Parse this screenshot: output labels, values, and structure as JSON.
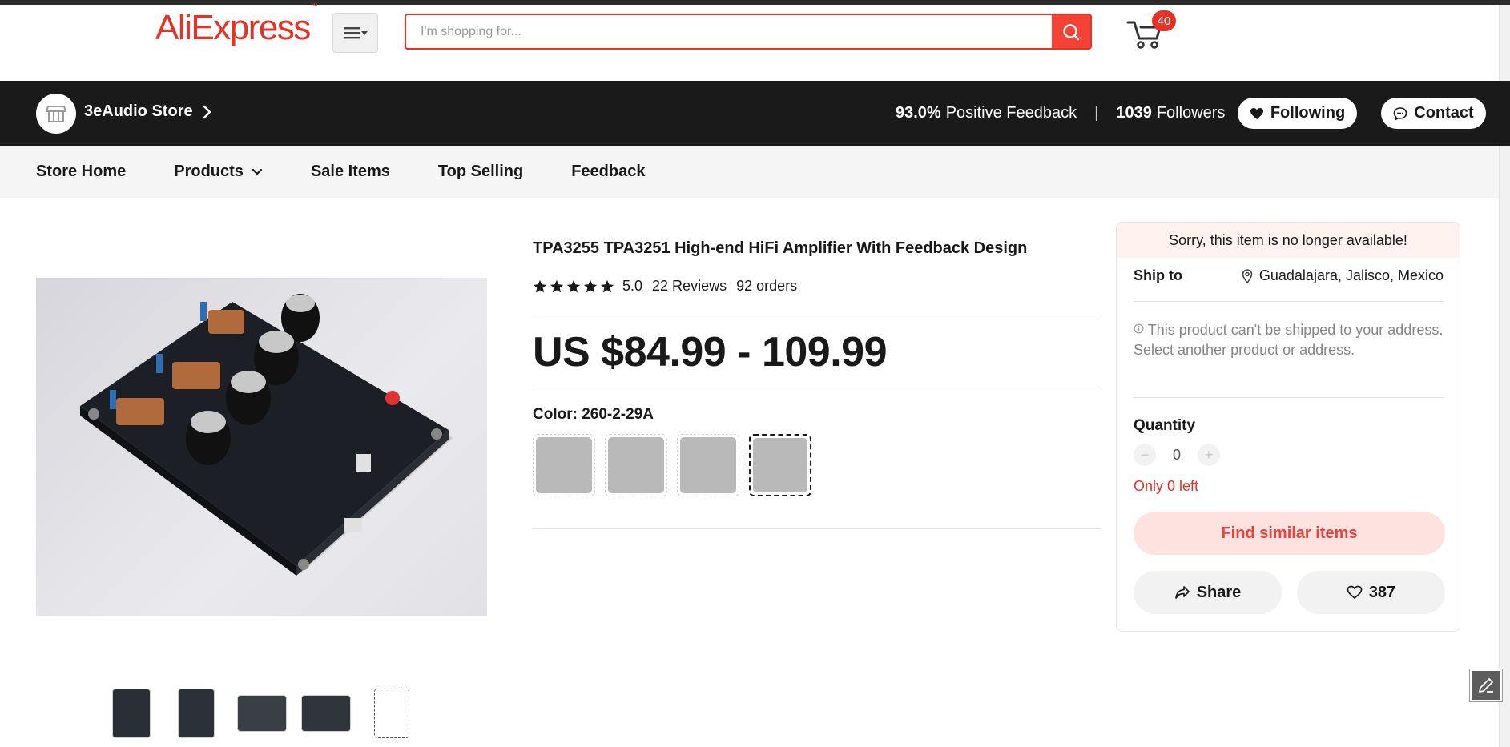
{
  "header": {
    "logo_text": "AliExpress",
    "logo_mark": "™",
    "search_placeholder": "I'm shopping for...",
    "cart_count": "40",
    "brand_color": "#e43225"
  },
  "store": {
    "name": "3eAudio Store",
    "feedback_value": "93.0%",
    "feedback_label": "Positive Feedback",
    "followers_value": "1039",
    "followers_label": "Followers",
    "separator": "|",
    "following_label": "Following",
    "contact_label": "Contact"
  },
  "store_nav": {
    "items": [
      {
        "label": "Store Home"
      },
      {
        "label": "Products"
      },
      {
        "label": "Sale Items"
      },
      {
        "label": "Top Selling"
      },
      {
        "label": "Feedback"
      }
    ]
  },
  "product": {
    "title": "TPA3255 TPA3251 High-end HiFi Amplifier With Feedback Design",
    "rating_score": "5.0",
    "reviews": "22 Reviews",
    "orders": "92 orders",
    "price": "US $84.99 - 109.99",
    "color_label": "Color: 260-2-29A",
    "swatch_count_visible": 4,
    "selected_swatch": 4
  },
  "buybox": {
    "unavailable_notice": "Sorry, this item is no longer available!",
    "ship_to_label": "Ship to",
    "ship_to_location": "Guadalajara, Jalisco, Mexico",
    "ship_msg_line1": "This product can't be shipped to your address.",
    "ship_msg_line2": "Select another product or address.",
    "quantity_label": "Quantity",
    "quantity_value": "0",
    "minus": "−",
    "plus": "+",
    "only_left": "Only 0 left",
    "find_similar": "Find similar items",
    "share_label": "Share",
    "wishlist_count": "387"
  }
}
